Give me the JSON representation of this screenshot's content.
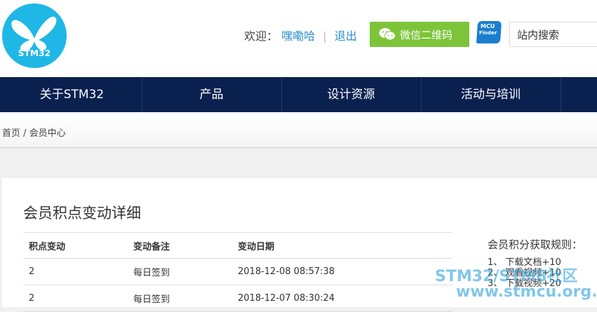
{
  "header": {
    "logo_text": "STM32",
    "welcome_prefix": "欢迎：",
    "username": "嘿嘞哈",
    "separator": "|",
    "logout": "退出",
    "wechat_label": "微信二维码",
    "mcu_line1": "MCU",
    "mcu_line2": "Finder",
    "search_value": "站内搜索"
  },
  "nav": {
    "items": [
      {
        "label": "关于STM32"
      },
      {
        "label": "产品"
      },
      {
        "label": "设计资源"
      },
      {
        "label": "活动与培训"
      }
    ]
  },
  "breadcrumb": {
    "text": "首页 / 会员中心"
  },
  "main": {
    "title": "会员积点变动详细",
    "table": {
      "headers": [
        "积点变动",
        "变动备注",
        "变动日期"
      ],
      "rows": [
        [
          "2",
          "每日签到",
          "2018-12-08 08:57:38"
        ],
        [
          "2",
          "每日签到",
          "2018-12-07 08:30:24"
        ]
      ]
    },
    "rules_title": "会员积分获取规则：",
    "rules": [
      "1、 下载文档+10",
      "2、 观看视频+10",
      "3、 下载视频+20"
    ]
  },
  "watermark": {
    "line1": "STM32/STM8社区",
    "line2": "www.stmcu.org.cn"
  },
  "colors": {
    "nav_bg": "#0a2150",
    "logo_bg": "#1fb7e6",
    "wechat_green": "#7dc43a",
    "link_blue": "#2a8ccf"
  }
}
